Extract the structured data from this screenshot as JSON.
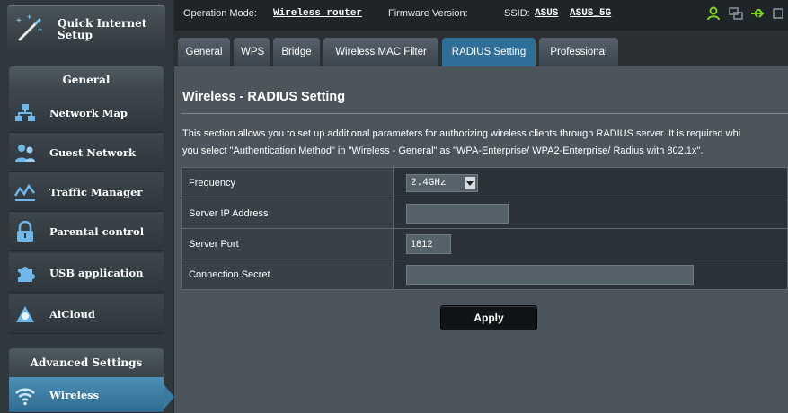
{
  "sidebar": {
    "quick_setup_label": "Quick Internet Setup",
    "general_header": "General",
    "items": [
      {
        "label": "Network Map",
        "icon": "network-map-icon"
      },
      {
        "label": "Guest Network",
        "icon": "guest-network-icon"
      },
      {
        "label": "Traffic Manager",
        "icon": "traffic-manager-icon"
      },
      {
        "label": "Parental control",
        "icon": "lock-icon"
      },
      {
        "label": "USB application",
        "icon": "puzzle-icon"
      },
      {
        "label": "AiCloud",
        "icon": "cloud-icon"
      }
    ],
    "advanced_header": "Advanced Settings",
    "active_item": {
      "label": "Wireless",
      "icon": "wifi-icon"
    }
  },
  "status_bar": {
    "operation_mode_label": "Operation Mode:",
    "operation_mode_value": "Wireless router",
    "firmware_label": "Firmware Version:",
    "ssid_label": "SSID:",
    "ssid_values": [
      "ASUS",
      "ASUS_5G"
    ],
    "icons": [
      "user-icon",
      "devices-icon",
      "usb-icon"
    ]
  },
  "tabs": [
    "General",
    "WPS",
    "Bridge",
    "Wireless MAC Filter",
    "RADIUS Setting",
    "Professional"
  ],
  "active_tab": "RADIUS Setting",
  "main": {
    "title": "Wireless - RADIUS Setting",
    "description_line1": "This section allows you to set up additional parameters for authorizing wireless clients through RADIUS server. It is required whi",
    "description_line2": "you select \"Authentication Method\" in \"Wireless - General\" as \"WPA-Enterprise/ WPA2-Enterprise/ Radius with 802.1x\".",
    "form": {
      "frequency_label": "Frequency",
      "frequency_value": "2.4GHz",
      "server_ip_label": "Server IP Address",
      "server_ip_value": "",
      "server_port_label": "Server Port",
      "server_port_value": "1812",
      "secret_label": "Connection Secret",
      "secret_value": ""
    },
    "apply_label": "Apply"
  },
  "colors": {
    "accent": "#2f6e96",
    "background": "#4b555b",
    "sidebar": "#2f383d"
  }
}
